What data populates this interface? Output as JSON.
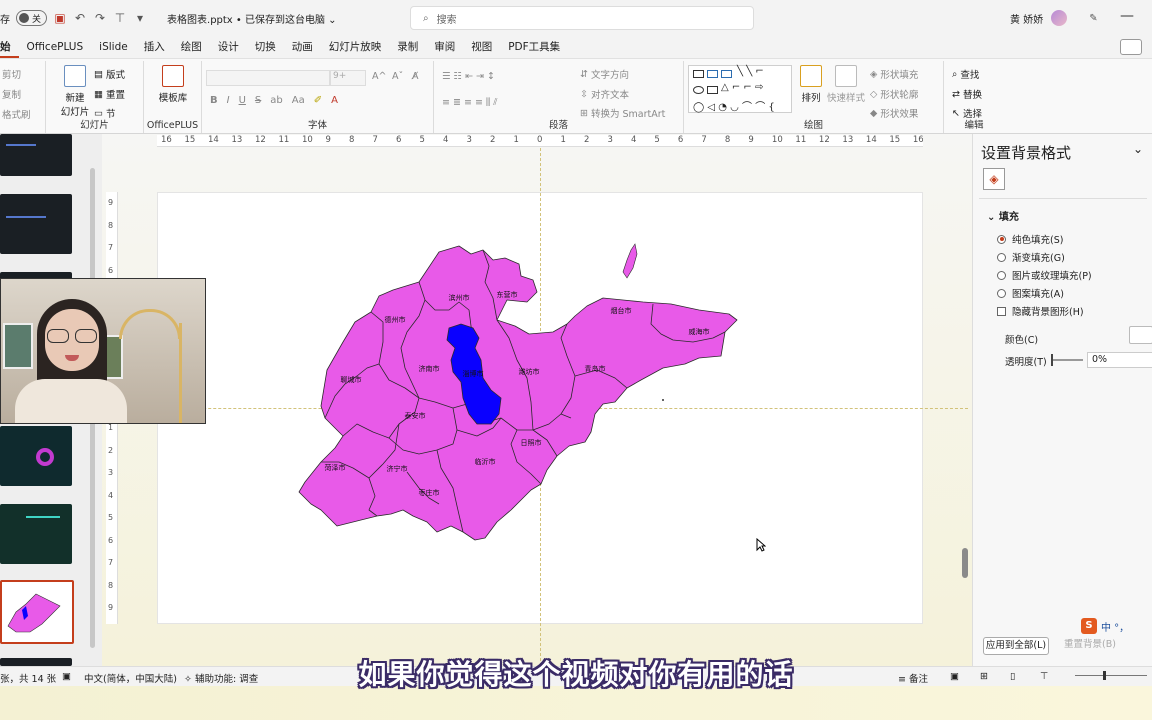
{
  "titlebar": {
    "autosave_prefix": "存",
    "autosave_toggle": "关",
    "doc_title": "表格图表.pptx • 已保存到这台电脑 ⌄",
    "search_placeholder": "搜索",
    "user_name": "黄 娇娇"
  },
  "menu": {
    "tabs": [
      "始",
      "OfficePLUS",
      "iSlide",
      "插入",
      "绘图",
      "设计",
      "切换",
      "动画",
      "幻灯片放映",
      "录制",
      "审阅",
      "视图",
      "PDF工具集"
    ]
  },
  "ribbon": {
    "clipboard": {
      "cut": "剪切",
      "copy": "复制",
      "painter": "格式刷"
    },
    "slides": {
      "new_slide": "新建\n幻灯片",
      "layout": "版式",
      "reset": "重置",
      "section": "节",
      "label": "幻灯片"
    },
    "officeplus": {
      "template": "模板库",
      "label": "OfficePLUS"
    },
    "font": {
      "size": "9+",
      "label": "字体",
      "bold": "B",
      "italic": "I",
      "underline": "U",
      "strike": "S",
      "case": "Aa"
    },
    "paragraph": {
      "text_dir": "文字方向",
      "align_text": "对齐文本",
      "smartart": "转换为 SmartArt",
      "label": "段落"
    },
    "drawing": {
      "arrange": "排列",
      "quick_styles": "快速样式",
      "fill": "形状填充",
      "outline": "形状轮廓",
      "effect": "形状效果",
      "label": "绘图"
    },
    "editing": {
      "find": "查找",
      "replace": "替换",
      "select": "选择",
      "label": "编辑"
    }
  },
  "map": {
    "regions": [
      "德州市",
      "滨州市",
      "东营市",
      "烟台市",
      "威海市",
      "聊城市",
      "济南市",
      "淄博市",
      "潍坊市",
      "青岛市",
      "泰安市",
      "日照市",
      "菏泽市",
      "济宁市",
      "临沂市",
      "枣庄市"
    ],
    "base_color": "#e85ae8",
    "highlight_color": "#0a00ff",
    "border_color": "#2a2a2a"
  },
  "format_pane": {
    "title": "设置背景格式",
    "section": "填充",
    "options": [
      "纯色填充(S)",
      "渐变填充(G)",
      "图片或纹理填充(P)",
      "图案填充(A)"
    ],
    "hide_bg": "隐藏背景图形(H)",
    "color_label": "颜色(C)",
    "transparency_label": "透明度(T)",
    "transparency_value": "0%",
    "apply_all": "应用到全部(L)",
    "reset": "重置背景(B)",
    "ime": "中 °，"
  },
  "statusbar": {
    "slide_count": "张，共 14 张",
    "language": "中文(简体，中国大陆)",
    "accessibility": "辅助功能: 调查",
    "notes": "备注"
  },
  "subtitle": "如果你觉得这个视频对你有用的话",
  "ruler": {
    "h": [
      "16",
      "15",
      "14",
      "13",
      "12",
      "11",
      "10",
      "9",
      "8",
      "7",
      "6",
      "5",
      "4",
      "3",
      "2",
      "1",
      "0",
      "1",
      "2",
      "3",
      "4",
      "5",
      "6",
      "7",
      "8",
      "9",
      "10",
      "11",
      "12",
      "13",
      "14",
      "15",
      "16"
    ],
    "v": [
      "9",
      "8",
      "7",
      "6",
      "5",
      "4",
      "3",
      "2",
      "1",
      "0",
      "1",
      "2",
      "3",
      "4",
      "5",
      "6",
      "7",
      "8",
      "9"
    ]
  }
}
